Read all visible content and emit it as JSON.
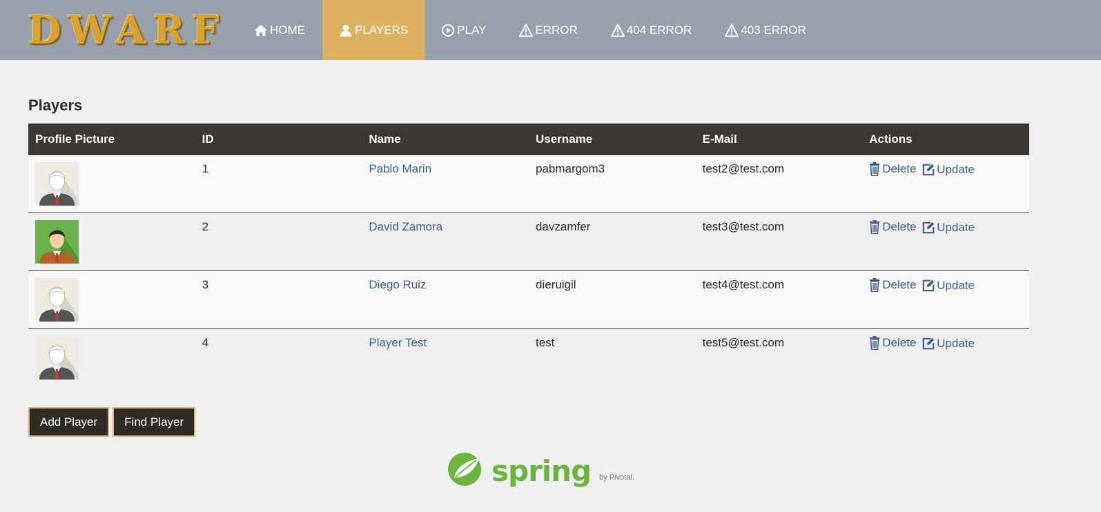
{
  "brand": {
    "name": "DWARF"
  },
  "nav": {
    "items": [
      {
        "label": "HOME",
        "icon": "home-icon"
      },
      {
        "label": "PLAYERS",
        "icon": "user-icon",
        "active": true
      },
      {
        "label": "PLAY",
        "icon": "play-circle-icon"
      },
      {
        "label": "ERROR",
        "icon": "warning-icon"
      },
      {
        "label": "404 ERROR",
        "icon": "warning-icon"
      },
      {
        "label": "403 ERROR",
        "icon": "warning-icon"
      }
    ]
  },
  "page": {
    "title": "Players"
  },
  "table": {
    "headers": [
      "Profile Picture",
      "ID",
      "Name",
      "Username",
      "E-Mail",
      "Actions"
    ],
    "rows": [
      {
        "avatar": "default-avatar",
        "id": "1",
        "name": "Pablo Marin",
        "username": "pabmargom3",
        "email": "test2@test.com",
        "delete": "Delete",
        "update": "Update"
      },
      {
        "avatar": "green-avatar",
        "id": "2",
        "name": "David Zamora",
        "username": "davzamfer",
        "email": "test3@test.com",
        "delete": "Delete",
        "update": "Update"
      },
      {
        "avatar": "default-avatar",
        "id": "3",
        "name": "Diego Ruiz",
        "username": "dieruigil",
        "email": "test4@test.com",
        "delete": "Delete",
        "update": "Update"
      },
      {
        "avatar": "default-avatar",
        "id": "4",
        "name": "Player Test",
        "username": "test",
        "email": "test5@test.com",
        "delete": "Delete",
        "update": "Update"
      }
    ]
  },
  "buttons": {
    "add": "Add Player",
    "find": "Find Player"
  },
  "footer": {
    "logo_text": "spring",
    "by_text": "by Pivotal."
  },
  "colors": {
    "navbar": "#98a0ab",
    "nav_active": "#dcb15f",
    "table_header": "#3b3732",
    "link": "#3f5f86",
    "button_bg": "#2e2b27",
    "button_border": "#dcb15f",
    "spring_green": "#6db33f"
  }
}
